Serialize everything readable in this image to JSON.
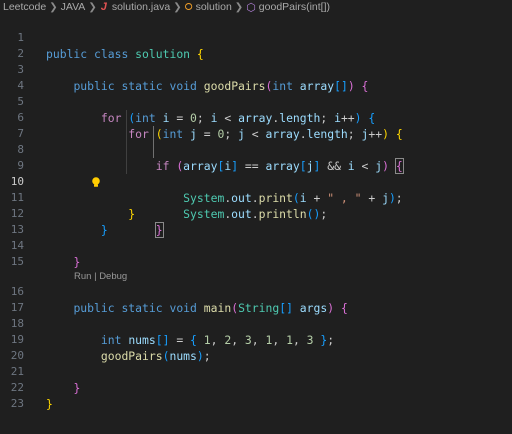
{
  "breadcrumb": {
    "items": [
      "Leetcode",
      "JAVA",
      "solution.java",
      "solution",
      "goodPairs(int[])"
    ],
    "file_icon": "J"
  },
  "codelens": {
    "run": "Run",
    "sep": "|",
    "debug": "Debug"
  },
  "line_numbers": [
    "1",
    "2",
    "3",
    "4",
    "5",
    "6",
    "7",
    "8",
    "9",
    "10",
    "11",
    "12",
    "13",
    "14",
    "15",
    "16",
    "17",
    "18",
    "19",
    "20",
    "21",
    "22",
    "23"
  ],
  "current_line": 10,
  "code": {
    "l1": [
      "public",
      "class",
      "solution",
      "{"
    ],
    "l3": [
      "public",
      "static",
      "void",
      "goodPairs",
      "(",
      "int",
      "array",
      "[]",
      ")",
      "{"
    ],
    "l5": [
      "for",
      "(",
      "int",
      "i",
      "=",
      "0",
      ";",
      "i",
      "<",
      "array",
      ".",
      "length",
      ";",
      "i",
      "++",
      ")",
      "{"
    ],
    "l6": [
      "for",
      "(",
      "int",
      "j",
      "=",
      "0",
      ";",
      "j",
      "<",
      "array",
      ".",
      "length",
      ";",
      "j",
      "++",
      ")",
      "{"
    ],
    "l7": [
      "if",
      "(",
      "array",
      "[",
      "i",
      "]",
      "==",
      "array",
      "[",
      "j",
      "]",
      "&&",
      "i",
      "<",
      "j",
      ")",
      "{"
    ],
    "l8": [
      "System",
      ".",
      "out",
      ".",
      "print",
      "(",
      "i",
      "+",
      "\" , \"",
      "+",
      "j",
      ")",
      ";"
    ],
    "l9": [
      "System",
      ".",
      "out",
      ".",
      "println",
      "(",
      ")",
      ";"
    ],
    "l10": [
      "}"
    ],
    "l11": [
      "}"
    ],
    "l12": [
      "}"
    ],
    "l14": [
      "}"
    ],
    "l16": [
      "public",
      "static",
      "void",
      "main",
      "(",
      "String",
      "[]",
      "args",
      ")",
      "{"
    ],
    "l18": [
      "int",
      "nums",
      "[]",
      "=",
      "{",
      "1",
      "2",
      "3",
      "1",
      "1",
      "3",
      "}",
      ";"
    ],
    "l19": [
      "goodPairs",
      "(",
      "nums",
      ")",
      ";"
    ],
    "l21": [
      "}"
    ],
    "l22": [
      "}"
    ]
  },
  "colors": {
    "background": "#1f1f1f",
    "keyword": "#569cd6",
    "control": "#c586c0",
    "function": "#dcdcaa",
    "variable": "#9cdcfe",
    "type": "#4ec9b0",
    "number": "#b5cea8",
    "string": "#ce9178",
    "bracket1": "#ffd700",
    "bracket2": "#da70d6",
    "bracket3": "#179fff"
  },
  "icons": [
    "chevron-right-icon",
    "java-file-icon",
    "class-icon",
    "method-icon",
    "lightbulb-icon"
  ]
}
